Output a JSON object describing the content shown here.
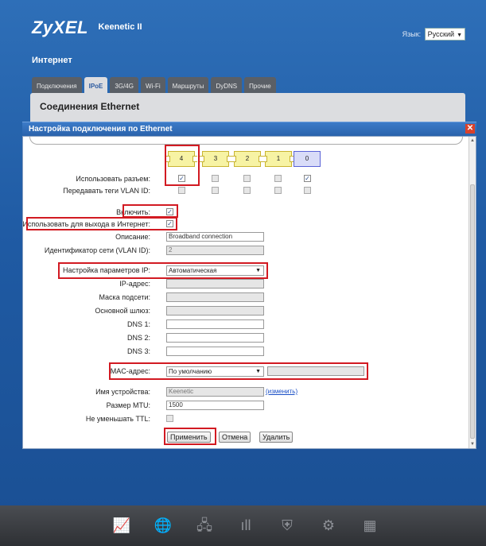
{
  "header": {
    "brand": "ZyXEL",
    "model": "Keenetic II",
    "page_title": "Интернет",
    "language_label": "Язык:",
    "language_value": "Русский"
  },
  "tabs": [
    {
      "label": "Подключения"
    },
    {
      "label": "IPoE",
      "active": true
    },
    {
      "label": "3G/4G"
    },
    {
      "label": "Wi-Fi"
    },
    {
      "label": "Маршруты"
    },
    {
      "label": "DyDNS"
    },
    {
      "label": "Прочие"
    }
  ],
  "panel_title": "Соединения Ethernet",
  "dialog": {
    "title": "Настройка подключения по Ethernet",
    "close_symbol": "✕",
    "ports": [
      "4",
      "3",
      "2",
      "1",
      "0"
    ],
    "use_port_label": "Использовать разъем:",
    "use_port_checked": [
      true,
      false,
      false,
      false,
      true
    ],
    "vlan_tags_label": "Передавать теги VLAN ID:",
    "enable_label": "Включить:",
    "enable_checked": true,
    "internet_label": "Использовать для выхода в Интернет:",
    "internet_checked": true,
    "description_label": "Описание:",
    "description_value": "Broadband connection",
    "vlan_id_label": "Идентификатор сети (VLAN ID):",
    "vlan_id_value": "2",
    "ip_settings_label": "Настройка параметров IP:",
    "ip_settings_value": "Автоматическая",
    "ip_label": "IP-адрес:",
    "mask_label": "Маска подсети:",
    "gateway_label": "Основной шлюз:",
    "dns1_label": "DNS 1:",
    "dns2_label": "DNS 2:",
    "dns3_label": "DNS 3:",
    "mac_label": "MAC-адрес:",
    "mac_value": "По умолчанию",
    "device_name_label": "Имя устройства:",
    "device_name_value": "Keenetic",
    "change_link": "(изменить)",
    "mtu_label": "Размер MTU:",
    "mtu_value": "1500",
    "ttl_label": "Не уменьшать TTL:",
    "apply_button": "Применить",
    "cancel_button": "Отмена",
    "delete_button": "Удалить"
  },
  "taskbar": [
    {
      "icon": "chart-icon"
    },
    {
      "icon": "globe-icon",
      "active": true
    },
    {
      "icon": "network-icon"
    },
    {
      "icon": "signal-icon"
    },
    {
      "icon": "shield-icon"
    },
    {
      "icon": "gear-icon"
    },
    {
      "icon": "grid-icon"
    }
  ],
  "colors": {
    "background": "#1f5aa3",
    "highlight": "#d21a22",
    "port_lan": "#f7f3a4",
    "port_wan": "#d9dcf8"
  }
}
